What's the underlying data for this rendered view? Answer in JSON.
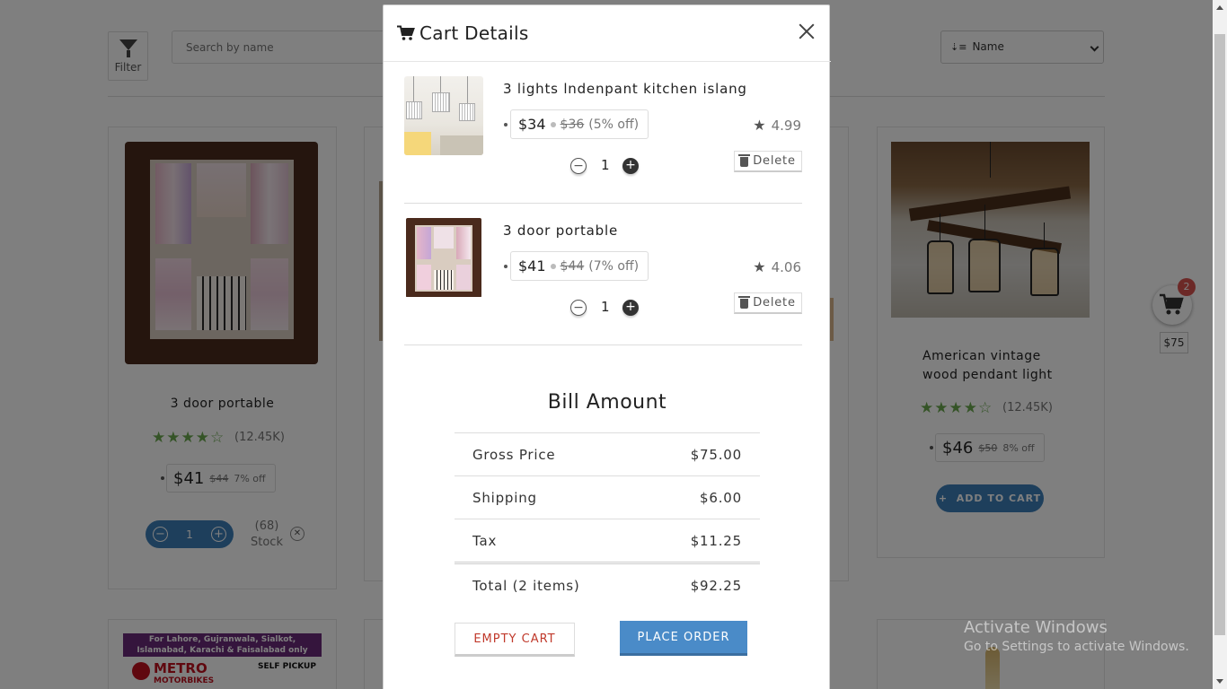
{
  "toolbar": {
    "filter_label": "Filter",
    "search_placeholder": "Search by name",
    "sort_value": "Name"
  },
  "products": [
    {
      "name": "3 door portable",
      "review_count": "(12.45K)",
      "price": "$41",
      "old_price": "$44",
      "discount": "7% off",
      "qty": "1",
      "stock_count": "(68)",
      "stock_label": "Stock"
    },
    {
      "name": "American vintage wood pendant light",
      "review_count": "(12.45K)",
      "price": "$46",
      "old_price": "$50",
      "discount": "8% off",
      "add_to_cart": "ADD TO CART"
    }
  ],
  "floating_cart": {
    "badge": "2",
    "total": "$75"
  },
  "banner": {
    "line1": "For Lahore, Gujranwala, Sialkot,",
    "line2": "Islamabad, Karachi & Faisalabad only",
    "brand_line1": "METRO",
    "brand_line2": "MOTORBIKES",
    "pickup": "SELF PICKUP"
  },
  "watermark": {
    "title": "Activate Windows",
    "subtitle": "Go to Settings to activate Windows."
  },
  "modal": {
    "title": "Cart Details",
    "items": [
      {
        "name": "3 lights lndenpant kitchen islang",
        "price": "$34",
        "old_price": "$36",
        "discount": "(5% off)",
        "rating": "4.99",
        "qty": "1",
        "delete_label": "Delete"
      },
      {
        "name": "3 door portable",
        "price": "$41",
        "old_price": "$44",
        "discount": "(7% off)",
        "rating": "4.06",
        "qty": "1",
        "delete_label": "Delete"
      }
    ],
    "bill": {
      "title": "Bill Amount",
      "rows": [
        {
          "label": "Gross Price",
          "value": "$75.00"
        },
        {
          "label": "Shipping",
          "value": "$6.00"
        },
        {
          "label": "Tax",
          "value": "$11.25"
        },
        {
          "label": "Total (2 items)",
          "value": "$92.25"
        }
      ]
    },
    "empty_cart_label": "EMPTY CART",
    "place_order_label": "PLACE ORDER"
  },
  "colors": {
    "accent": "#3d7fb9",
    "primary_button": "#4a8bc8",
    "danger_text": "#c0392b",
    "star_green": "#6aa84f",
    "badge_red": "#d9534f"
  }
}
